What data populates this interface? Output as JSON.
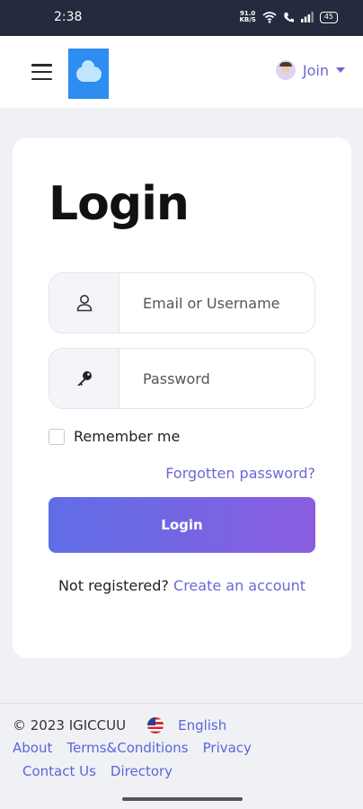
{
  "status_bar": {
    "time": "2:38",
    "network_speed": "91.0",
    "network_unit": "KB/S",
    "battery": "45"
  },
  "header": {
    "join_label": "Join"
  },
  "login": {
    "title": "Login",
    "username_placeholder": "Email or Username",
    "password_placeholder": "Password",
    "remember_label": "Remember me",
    "forgot_label": "Forgotten password?",
    "button_label": "Login",
    "not_registered_text": "Not registered?",
    "create_account_label": "Create an account"
  },
  "footer": {
    "copyright": "© 2023 IGICCUU",
    "language": "English",
    "links": [
      "About",
      "Terms&Conditions",
      "Privacy",
      "Contact Us",
      "Directory"
    ]
  },
  "colors": {
    "accent": "#6a68d8",
    "button_start": "#5f6ee6",
    "button_end": "#8a5de0",
    "status_bar": "#262a3e"
  },
  "icons": [
    "hamburger-menu-icon",
    "app-logo-icon",
    "avatar-icon",
    "chevron-down-icon",
    "user-icon",
    "key-icon",
    "checkbox-icon",
    "us-flag-icon"
  ]
}
